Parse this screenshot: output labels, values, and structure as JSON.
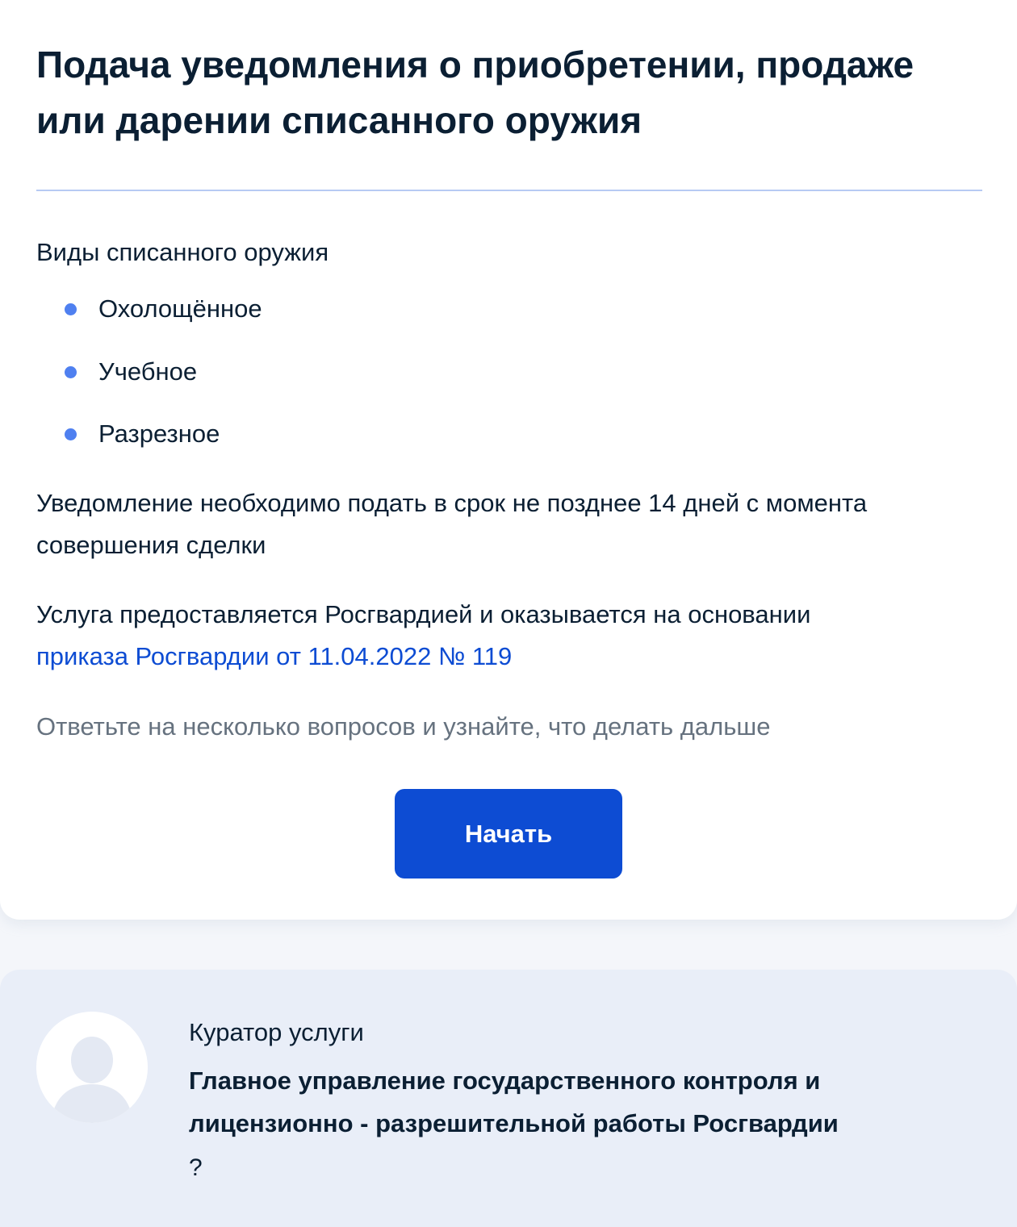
{
  "page": {
    "title": "Подача уведомления о приобретении, продаже или дарении списанного оружия",
    "kinds_label": "Виды списанного оружия",
    "kinds": [
      "Охолощённое",
      "Учебное",
      "Разрезное"
    ],
    "deadline_text": "Уведомление необходимо подать в срок не позднее 14 дней с момента совершения сделки",
    "provider_text": "Услуга предоставляется Росгвардией и оказывается на основании",
    "provider_link": "приказа Росгвардии от 11.04.2022 № 119",
    "hint": "Ответьте на несколько вопросов и узнайте, что делать дальше",
    "start_button": "Начать"
  },
  "curator": {
    "label": "Куратор услуги",
    "name": "Главное управление государственного контроля и лицензионно - разрешительной работы Росгвардии",
    "help_icon": "?"
  },
  "colors": {
    "accent": "#0d4cd3",
    "bullet": "#4f80f0",
    "text": "#0b1f33",
    "muted": "#66727f",
    "curator_bg": "#e9eef8"
  },
  "icons": {
    "bullet": "bullet-dot-icon",
    "avatar": "user-avatar-icon",
    "help": "question-mark-icon"
  }
}
